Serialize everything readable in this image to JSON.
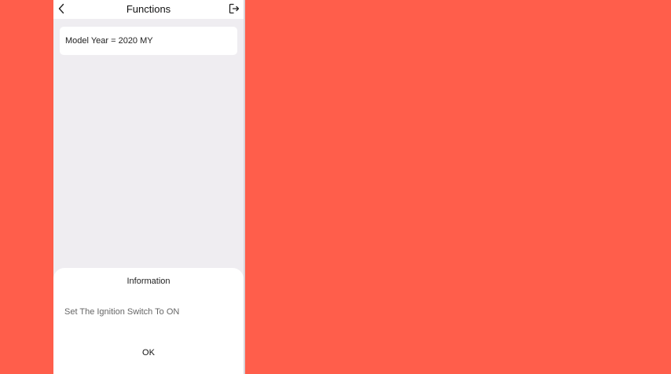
{
  "header": {
    "title": "Functions",
    "back_icon": "chevron-left-icon",
    "exit_icon": "exit-icon"
  },
  "main": {
    "items": [
      {
        "label": "Model Year = 2020 MY"
      }
    ]
  },
  "dialog": {
    "title": "Information",
    "message": "Set The Ignition Switch To ON",
    "ok_label": "OK"
  },
  "colors": {
    "background": "#FF5E4B",
    "screen": "#EFEDF1",
    "surface": "#FFFFFF"
  }
}
